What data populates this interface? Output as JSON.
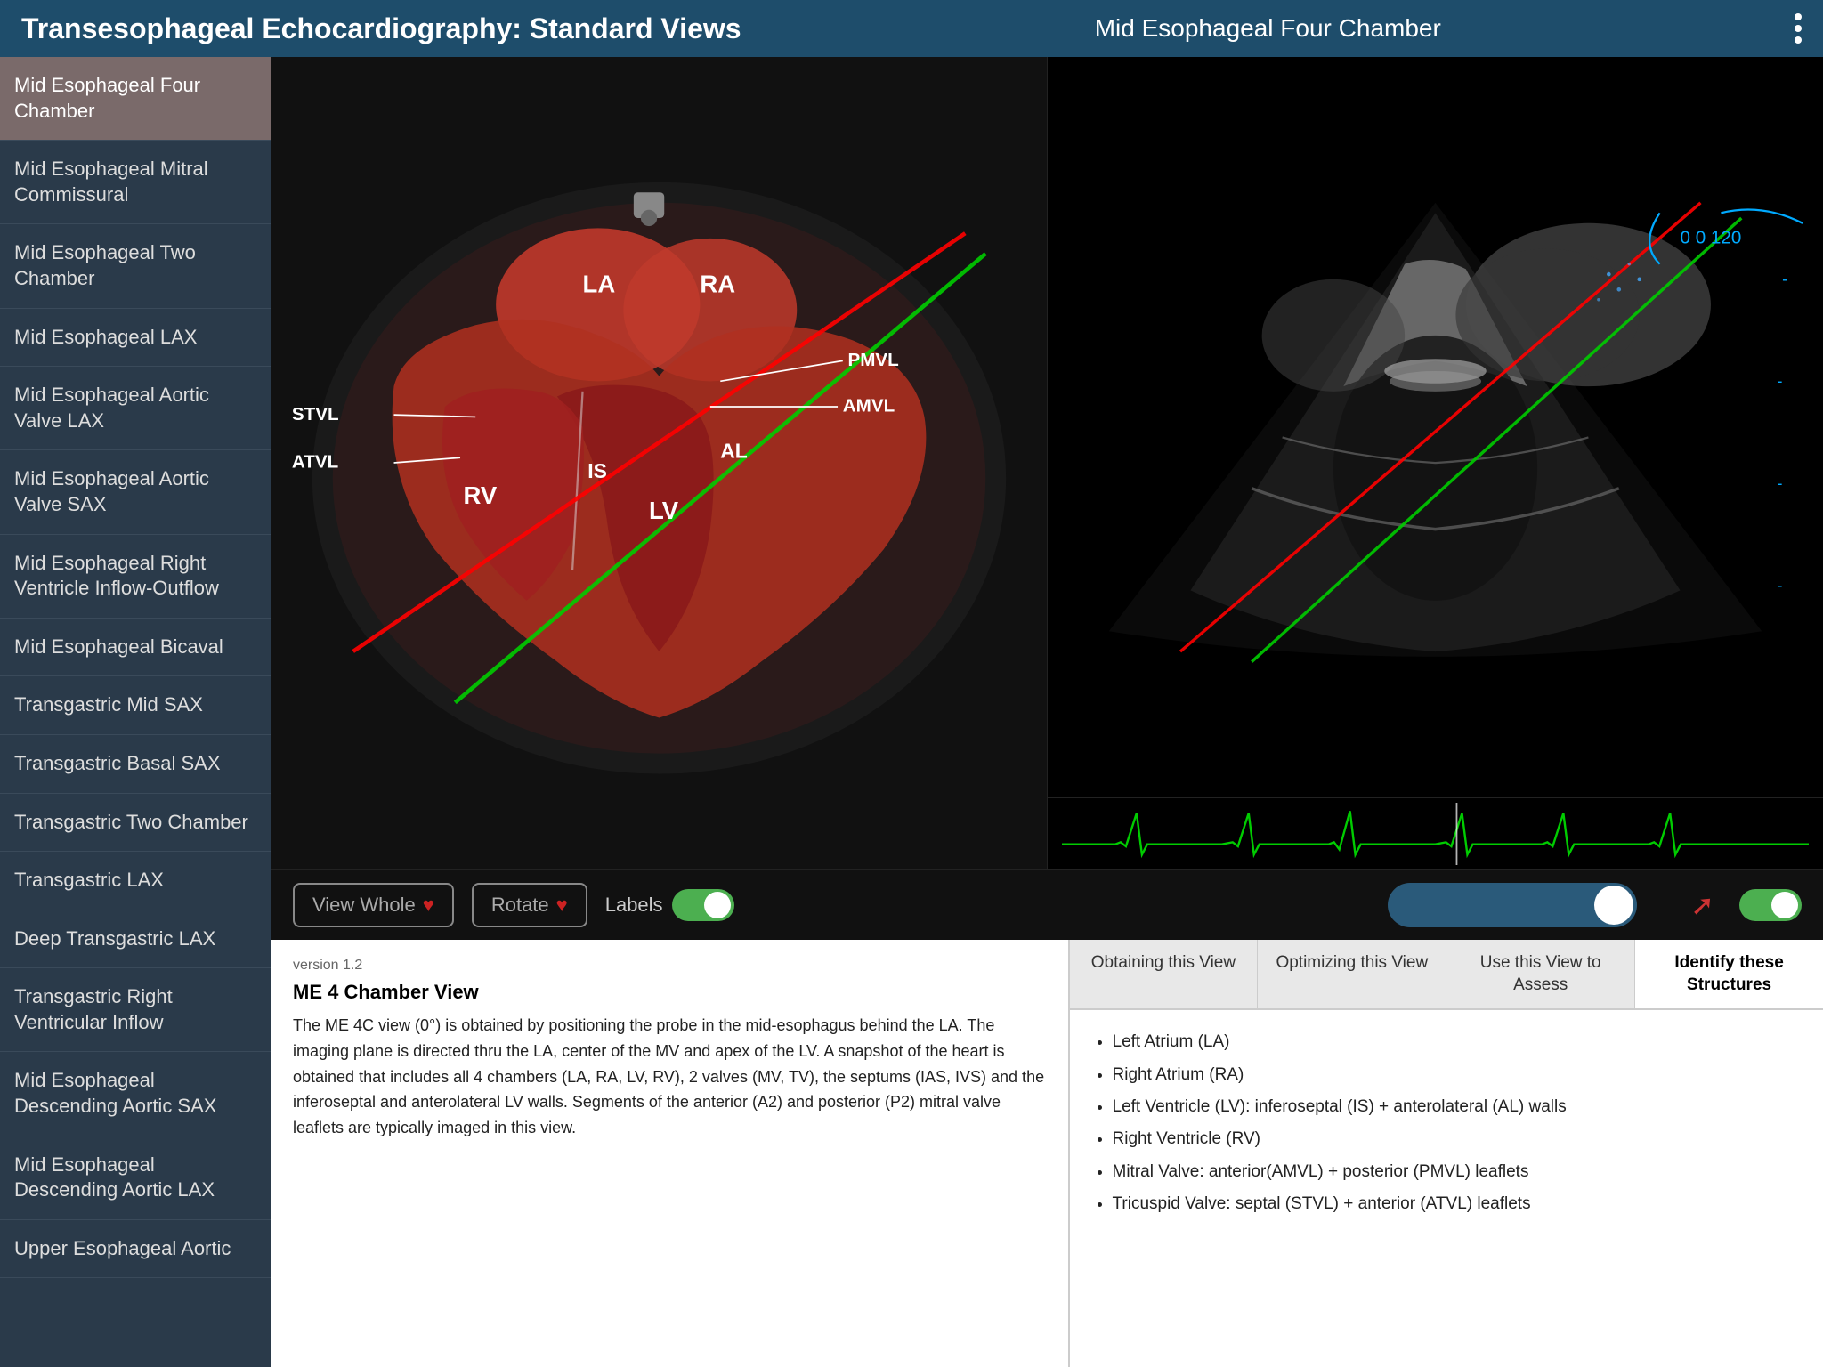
{
  "header": {
    "title": "Transesophageal Echocardiography: Standard Views",
    "current_view": "Mid Esophageal Four Chamber",
    "dots_label": "menu"
  },
  "sidebar": {
    "items": [
      {
        "id": "me-four-chamber",
        "label": "Mid Esophageal Four Chamber",
        "active": true
      },
      {
        "id": "me-mitral-commissural",
        "label": "Mid Esophageal Mitral Commissural",
        "active": false
      },
      {
        "id": "me-two-chamber",
        "label": "Mid Esophageal Two Chamber",
        "active": false
      },
      {
        "id": "me-lax",
        "label": "Mid Esophageal LAX",
        "active": false
      },
      {
        "id": "me-aortic-lax",
        "label": "Mid Esophageal Aortic Valve LAX",
        "active": false
      },
      {
        "id": "me-aortic-sax",
        "label": "Mid Esophageal Aortic Valve SAX",
        "active": false
      },
      {
        "id": "me-rv-inflow",
        "label": "Mid Esophageal Right Ventricle Inflow-Outflow",
        "active": false
      },
      {
        "id": "me-bicaval",
        "label": "Mid Esophageal Bicaval",
        "active": false
      },
      {
        "id": "tg-mid-sax",
        "label": "Transgastric Mid SAX",
        "active": false
      },
      {
        "id": "tg-basal-sax",
        "label": "Transgastric Basal SAX",
        "active": false
      },
      {
        "id": "tg-two-chamber",
        "label": "Transgastric Two Chamber",
        "active": false
      },
      {
        "id": "tg-lax",
        "label": "Transgastric LAX",
        "active": false
      },
      {
        "id": "deep-tg-lax",
        "label": "Deep Transgastric LAX",
        "active": false
      },
      {
        "id": "tg-rv-inflow",
        "label": "Transgastric Right Ventricular Inflow",
        "active": false
      },
      {
        "id": "me-desc-sax",
        "label": "Mid Esophageal Descending Aortic SAX",
        "active": false
      },
      {
        "id": "me-desc-lax",
        "label": "Mid Esophageal Descending Aortic LAX",
        "active": false
      },
      {
        "id": "ue-aortic",
        "label": "Upper Esophageal Aortic",
        "active": false
      }
    ]
  },
  "controls": {
    "view_whole_label": "View Whole",
    "rotate_label": "Rotate",
    "labels_label": "Labels",
    "labels_on": true,
    "blue_toggle_on": true,
    "red_toggle_on": true
  },
  "heart_labels": {
    "LA": "LA",
    "RA": "RA",
    "RV": "RV",
    "LV": "LV",
    "IS": "IS",
    "AL": "AL",
    "STVL": "STVL",
    "ATVL": "ATVL",
    "PMVL": "PMVL",
    "AMVL": "AMVL"
  },
  "angle_display": "0  0  120",
  "version": "version 1.2",
  "text_panel": {
    "title": "ME 4 Chamber View",
    "body": "The ME 4C view (0°) is obtained by positioning the probe in the mid-esophagus behind the LA. The imaging plane is directed thru the LA, center of the MV and apex of the LV. A snapshot of the heart is obtained that includes all 4 chambers (LA, RA, LV, RV), 2 valves (MV, TV), the septums (IAS, IVS) and the inferoseptal and anterolateral LV walls. Segments of the anterior (A2) and posterior (P2) mitral valve leaflets are typically imaged in this view."
  },
  "info_tabs": [
    {
      "id": "obtaining",
      "label": "Obtaining this View",
      "active": false
    },
    {
      "id": "optimizing",
      "label": "Optimizing this View",
      "active": false
    },
    {
      "id": "use-assess",
      "label": "Use this View to Assess",
      "active": false
    },
    {
      "id": "identify",
      "label": "Identify these Structures",
      "active": true
    }
  ],
  "structures": [
    "Left Atrium (LA)",
    "Right Atrium (RA)",
    "Left Ventricle (LV): inferoseptal (IS) + anterolateral (AL) walls",
    "Right Ventricle (RV)",
    "Mitral Valve: anterior(AMVL) + posterior (PMVL) leaflets",
    "Tricuspid Valve: septal (STVL) + anterior (ATVL) leaflets"
  ]
}
